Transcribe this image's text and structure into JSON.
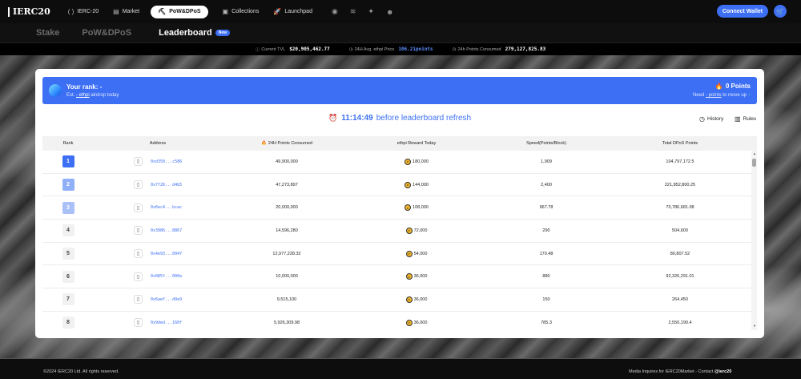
{
  "nav": {
    "logo": "IERC20",
    "items": [
      {
        "icon": "( )",
        "label": "IERC-20"
      },
      {
        "icon": "▤",
        "label": "Market"
      },
      {
        "icon": "⛏",
        "label": "PoW&DPoS"
      },
      {
        "icon": "▣",
        "label": "Collections"
      },
      {
        "icon": "🚀",
        "label": "Launchpad"
      }
    ],
    "social_icons": [
      "github-icon",
      "layers-icon",
      "twitter-icon",
      "discord-icon"
    ],
    "connect_wallet": "Connect Wallet"
  },
  "subnav": {
    "tabs": [
      "Stake",
      "PoW&DPoS",
      "Leaderboard"
    ],
    "badge": "New"
  },
  "stats": {
    "tvl_label": "Current TVL",
    "tvl_value": "$20,905,462.77",
    "avg_label": "24H Avg. ethpi Price",
    "avg_value": "106.21points",
    "consumed_label": "24h Points Consumed",
    "consumed_value": "279,127,825.83"
  },
  "rank_card": {
    "title": "Your rank: -",
    "sub_prefix": "Est. ",
    "sub_link": "- ethpi",
    "sub_suffix": " airdrop today",
    "points": "0 Points",
    "need_prefix": "Need ",
    "need_link": "- points",
    "need_suffix": " to move up"
  },
  "timer": {
    "time": "11:14:49",
    "text": "before leaderboard refresh",
    "history": "History",
    "rules": "Rules"
  },
  "table": {
    "headers": [
      "Rank",
      "Address",
      "24H Points Consumed",
      "ethpi Reward Today",
      "Speed(Points/Block)",
      "Total DPoS Points"
    ],
    "rows": [
      {
        "rank": "1",
        "addr": "0xd350...c586",
        "consumed": "49,900,000",
        "reward": "180,000",
        "speed": "1,909",
        "total": "104,797,172.5"
      },
      {
        "rank": "2",
        "addr": "0x7f26...d4b5",
        "consumed": "47,273,897",
        "reward": "144,000",
        "speed": "2,400",
        "total": "221,852,800.25"
      },
      {
        "rank": "3",
        "addr": "0x6ec4...bcac",
        "consumed": "20,000,000",
        "reward": "108,000",
        "speed": "967.78",
        "total": "70,786,681.08"
      },
      {
        "rank": "4",
        "addr": "0x3986...8867",
        "consumed": "14,596,280",
        "reward": "72,000",
        "speed": "290",
        "total": "504,600"
      },
      {
        "rank": "5",
        "addr": "0x4e93...0947",
        "consumed": "12,977,228.32",
        "reward": "54,000",
        "speed": "170.48",
        "total": "80,807.52"
      },
      {
        "rank": "6",
        "addr": "0x085f...000e",
        "consumed": "10,000,000",
        "reward": "36,000",
        "speed": "880",
        "total": "92,326,291.01"
      },
      {
        "rank": "7",
        "addr": "0x6aef...d9e9",
        "consumed": "9,515,100",
        "reward": "36,000",
        "speed": "150",
        "total": "264,450"
      },
      {
        "rank": "8",
        "addr": "0x9ded...160f",
        "consumed": "5,926,309.98",
        "reward": "36,000",
        "speed": "785.3",
        "total": "2,550,190.4"
      }
    ]
  },
  "footer": {
    "copyright": "©2024 IERC20 Ltd. All rights reserved.",
    "media": "Media Inquires for IERC20Market - Contact",
    "contact": "@ierc20"
  }
}
